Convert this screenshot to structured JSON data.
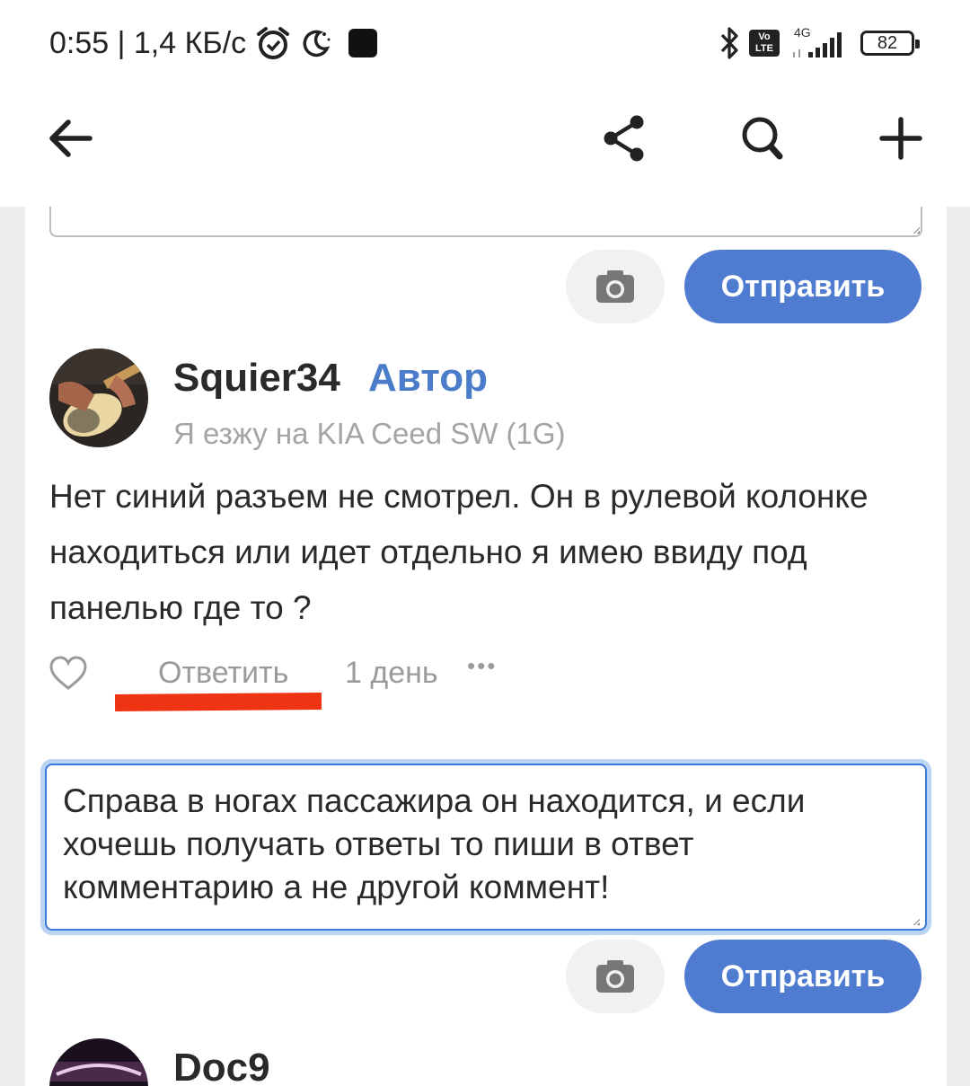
{
  "status_bar": {
    "time_speed": "0:55 | 1,4 КБ/с",
    "volte": "Vo LTE",
    "network": "4G",
    "battery": "82"
  },
  "toolbar": {
    "back_icon": "arrow-left-icon",
    "share_icon": "share-icon",
    "search_icon": "search-icon",
    "add_icon": "plus-icon"
  },
  "top_reply_form": {
    "text": "",
    "send_label": "Отправить"
  },
  "comment": {
    "username": "Squier34",
    "author_tag": "Автор",
    "car": "Я езжу на KIA Ceed SW (1G)",
    "text": "Нет синий разъем не смотрел. Он в рулевой колонке находиться или идет отдельно я имею ввиду под панелью где то ?",
    "reply_label": "Ответить",
    "time": "1 день",
    "more_label": "•••"
  },
  "reply_form": {
    "text": "Справа в ногах пассажира он находится, и если хочешь получать ответы то пиши в ответ комментарию а не другой коммент!",
    "send_label": "Отправить"
  },
  "next_comment": {
    "username": "Doc9"
  },
  "colors": {
    "accent": "#4f7bd0",
    "author": "#4a7cc9",
    "highlight_underline": "#ee3413"
  }
}
